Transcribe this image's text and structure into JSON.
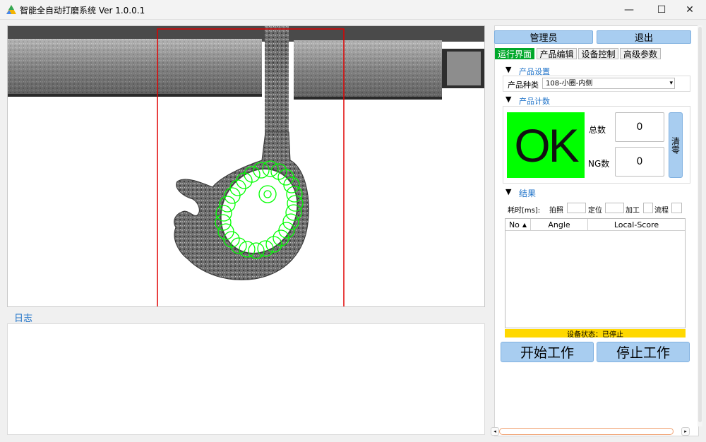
{
  "window": {
    "title": "智能全自动打磨系统 Ver 1.0.0.1",
    "minimize": "—",
    "maximize": "☐",
    "close": "✕"
  },
  "log": {
    "title": "日志"
  },
  "top_buttons": {
    "admin": "管理员",
    "exit": "退出"
  },
  "tabs": [
    "运行界面",
    "产品编辑",
    "设备控制",
    "高级参数"
  ],
  "product_settings": {
    "title": "产品设置",
    "type_label": "产品种类",
    "type_value": "108-小圈-内侧"
  },
  "product_count": {
    "title": "产品计数",
    "result": "OK",
    "total_label": "总数",
    "total_value": "0",
    "ng_label": "NG数",
    "ng_value": "0",
    "clear_label": "清零"
  },
  "results": {
    "title": "结果",
    "time_label": "耗时[ms]:",
    "capture_label": "拍照",
    "locate_label": "定位",
    "process_label": "加工",
    "flow_label": "流程",
    "columns": [
      "No",
      "Angle",
      "Local-Score"
    ],
    "status": "设备状态：已停止"
  },
  "controls": {
    "start": "开始工作",
    "stop": "停止工作"
  },
  "colors": {
    "accent": "#1f73c9",
    "button": "#a8cdf0",
    "active_tab": "#00a82a",
    "ok": "#00ff00",
    "status": "#ffd800",
    "roi": "#e00000",
    "contour": "#00ff00"
  }
}
